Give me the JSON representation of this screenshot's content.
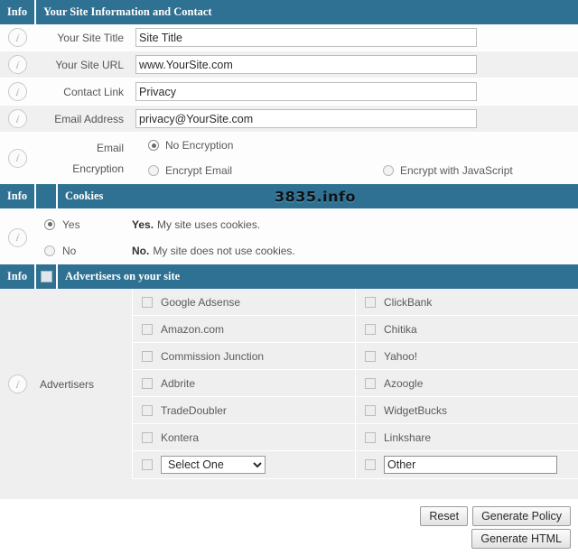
{
  "section_site": {
    "info_col_header": "Info",
    "title": "Your Site Information and Contact",
    "fields": [
      {
        "label": "Your Site Title",
        "value": "Site Title"
      },
      {
        "label": "Your Site URL",
        "value": "www.YourSite.com"
      },
      {
        "label": "Contact Link",
        "value": "Privacy"
      },
      {
        "label": "Email Address",
        "value": "privacy@YourSite.com"
      }
    ],
    "encryption": {
      "label_line1": "Email",
      "label_line2": "Encryption",
      "options": [
        {
          "label": "No Encryption",
          "selected": true
        },
        {
          "label": "Encrypt Email",
          "selected": false
        },
        {
          "label": "Encrypt with JavaScript",
          "selected": false
        }
      ]
    }
  },
  "section_cookies": {
    "info_col_header": "Info",
    "title": "Cookies",
    "watermark": "3835.info",
    "options": [
      {
        "radio_label": "Yes",
        "selected": true,
        "bold": "Yes.",
        "desc": "My site uses cookies."
      },
      {
        "radio_label": "No",
        "selected": false,
        "bold": "No.",
        "desc": "My site does not use cookies."
      }
    ]
  },
  "section_advertisers": {
    "info_col_header": "Info",
    "title": "Advertisers on your site",
    "row_label": "Advertisers",
    "rows": [
      {
        "left": "Google Adsense",
        "right": "ClickBank"
      },
      {
        "left": "Amazon.com",
        "right": "Chitika"
      },
      {
        "left": "Commission Junction",
        "right": "Yahoo!"
      },
      {
        "left": "Adbrite",
        "right": "Azoogle"
      },
      {
        "left": "TradeDoubler",
        "right": "WidgetBucks"
      },
      {
        "left": "Kontera",
        "right": "Linkshare"
      }
    ],
    "last_row": {
      "select_value": "Select One",
      "other_value": "Other"
    }
  },
  "buttons": {
    "reset": "Reset",
    "generate_policy": "Generate Policy",
    "generate_html": "Generate HTML"
  },
  "colors": {
    "header_bar": "#2e7192",
    "row_alt": "#f0f0f0",
    "advertiser_bg": "#efefef"
  }
}
